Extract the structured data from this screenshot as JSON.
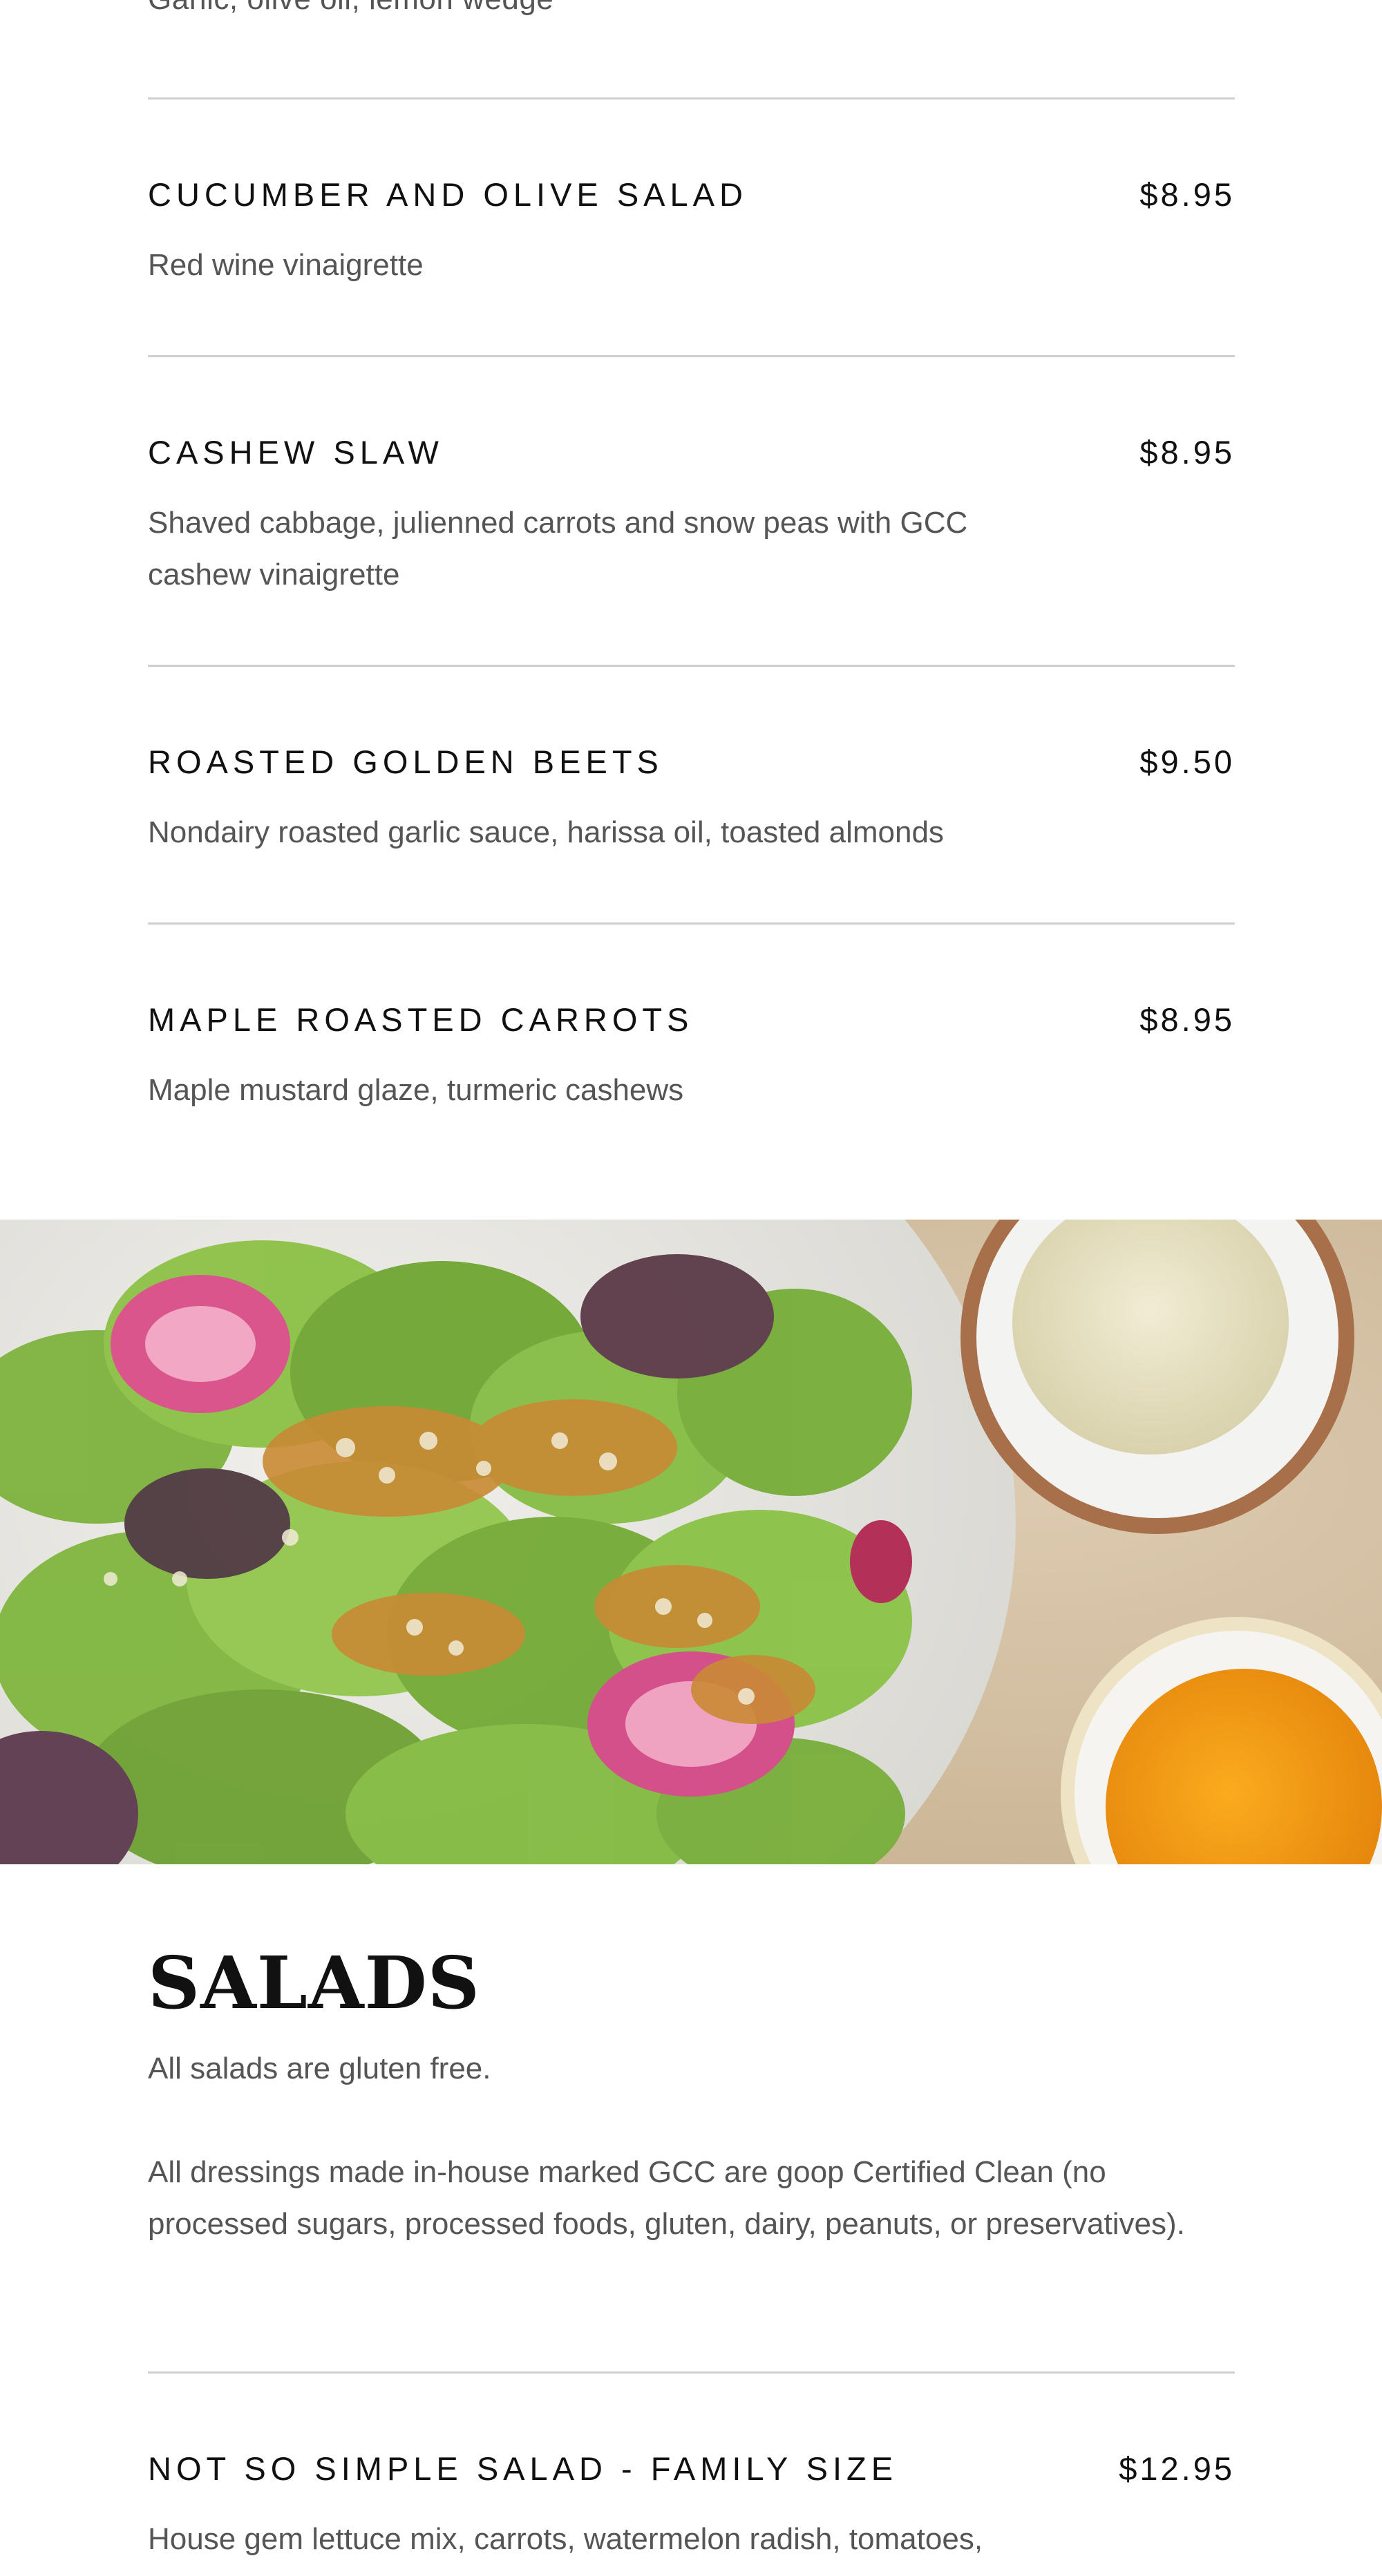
{
  "previous_item": {
    "description_cut": "Garlic, olive oil, lemon wedge"
  },
  "sides": {
    "items": [
      {
        "name": "CUCUMBER AND OLIVE SALAD",
        "price": "$8.95",
        "description": "Red wine vinaigrette"
      },
      {
        "name": "CASHEW SLAW",
        "price": "$8.95",
        "description": "Shaved cabbage, julienned carrots and snow peas with GCC cashew vinaigrette"
      },
      {
        "name": "ROASTED GOLDEN BEETS",
        "price": "$9.50",
        "description": "Nondairy roasted garlic sauce, harissa oil, toasted almonds"
      },
      {
        "name": "MAPLE ROASTED CARROTS",
        "price": "$8.95",
        "description": "Maple mustard glaze, turmeric cashews"
      }
    ]
  },
  "hero_image": {
    "subject": "salad-with-dressings-photo",
    "colors": {
      "plate": "#e9e8e4",
      "table": "#d6c3a8",
      "lettuce": "#7fb23a",
      "radish": "#d8568c",
      "aioli": "#ece7c9",
      "orange_sauce": "#f39a17"
    }
  },
  "salads": {
    "title": "SALADS",
    "note_1": "All salads are gluten free.",
    "note_2": "All dressings made in-house marked GCC are goop Certified Clean (no processed sugars, processed foods, gluten, dairy, peanuts, or preservatives).",
    "items": [
      {
        "name": "NOT SO SIMPLE SALAD - FAMILY SIZE",
        "price": "$12.95",
        "description": "House gem lettuce mix, carrots, watermelon radish, tomatoes,"
      }
    ]
  }
}
